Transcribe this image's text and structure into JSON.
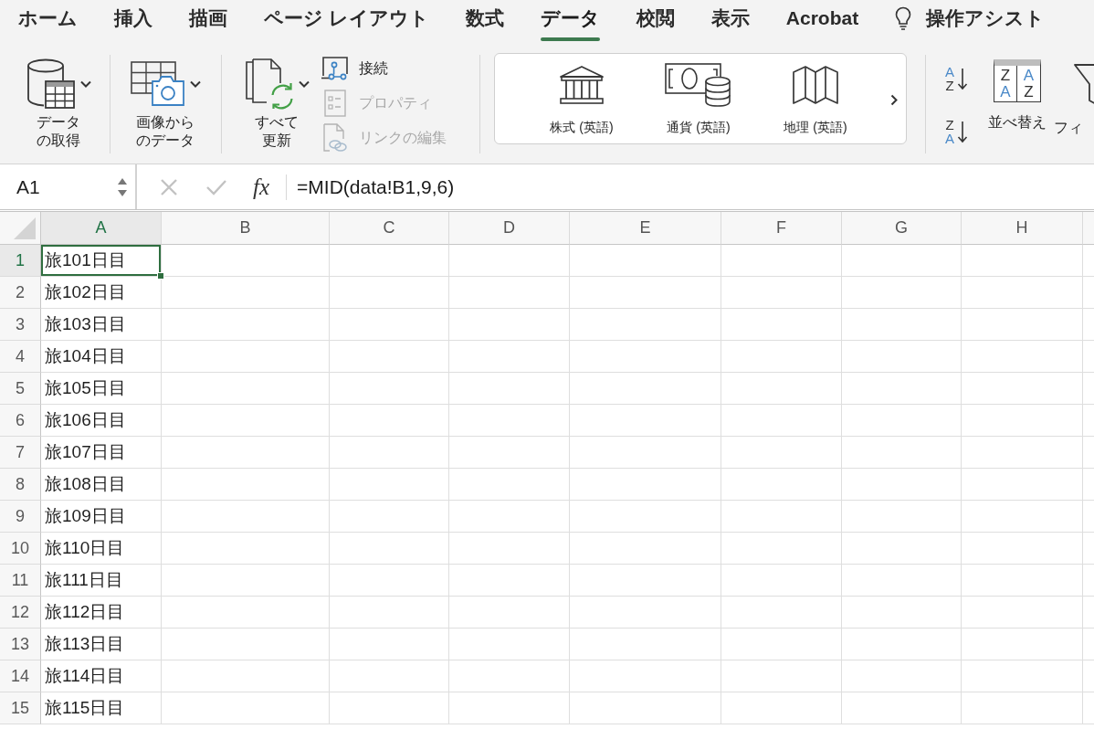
{
  "ribbon_tabs": [
    {
      "label": "ホーム",
      "selected": false
    },
    {
      "label": "挿入",
      "selected": false
    },
    {
      "label": "描画",
      "selected": false
    },
    {
      "label": "ページ レイアウト",
      "selected": false
    },
    {
      "label": "数式",
      "selected": false
    },
    {
      "label": "データ",
      "selected": true
    },
    {
      "label": "校閲",
      "selected": false
    },
    {
      "label": "表示",
      "selected": false
    },
    {
      "label": "Acrobat",
      "selected": false
    }
  ],
  "tell_me": {
    "label": "操作アシスト"
  },
  "ribbon": {
    "get_data": {
      "label": "データの取得"
    },
    "from_picture": {
      "label": "画像からのデータ"
    },
    "refresh_all": {
      "label": "すべて更新"
    },
    "queries": [
      {
        "label": "接続",
        "disabled": false
      },
      {
        "label": "プロパティ",
        "disabled": true
      },
      {
        "label": "リンクの編集",
        "disabled": true
      }
    ],
    "data_types": [
      {
        "label": "株式 (英語)"
      },
      {
        "label": "通貨 (英語)"
      },
      {
        "label": "地理 (英語)"
      }
    ],
    "sort_ascending": {
      "letters": [
        "A",
        "Z"
      ]
    },
    "sort_descending": {
      "letters": [
        "Z",
        "A"
      ]
    },
    "sort": {
      "letters": [
        [
          "Z",
          "A"
        ],
        [
          "A",
          "Z"
        ]
      ],
      "label": "並べ替え"
    },
    "filter": {
      "label": "フィ"
    }
  },
  "formula_bar": {
    "name_box": "A1",
    "function_button": "fx",
    "formula": "=MID(data!B1,9,6)"
  },
  "sheet": {
    "columns": [
      {
        "label": "A",
        "selected": true
      },
      {
        "label": "B",
        "selected": false
      },
      {
        "label": "C",
        "selected": false
      },
      {
        "label": "D",
        "selected": false
      },
      {
        "label": "E",
        "selected": false
      },
      {
        "label": "F",
        "selected": false
      },
      {
        "label": "G",
        "selected": false
      },
      {
        "label": "H",
        "selected": false
      }
    ],
    "rows": [
      {
        "label": "1",
        "selected": true,
        "cells": [
          {
            "value": "旅101日目",
            "active": true
          }
        ]
      },
      {
        "label": "2",
        "selected": false,
        "cells": [
          {
            "value": "旅102日目",
            "active": false
          }
        ]
      },
      {
        "label": "3",
        "selected": false,
        "cells": [
          {
            "value": "旅103日目",
            "active": false
          }
        ]
      },
      {
        "label": "4",
        "selected": false,
        "cells": [
          {
            "value": "旅104日目",
            "active": false
          }
        ]
      },
      {
        "label": "5",
        "selected": false,
        "cells": [
          {
            "value": "旅105日目",
            "active": false
          }
        ]
      },
      {
        "label": "6",
        "selected": false,
        "cells": [
          {
            "value": "旅106日目",
            "active": false
          }
        ]
      },
      {
        "label": "7",
        "selected": false,
        "cells": [
          {
            "value": "旅107日目",
            "active": false
          }
        ]
      },
      {
        "label": "8",
        "selected": false,
        "cells": [
          {
            "value": "旅108日目",
            "active": false
          }
        ]
      },
      {
        "label": "9",
        "selected": false,
        "cells": [
          {
            "value": "旅109日目",
            "active": false
          }
        ]
      },
      {
        "label": "10",
        "selected": false,
        "cells": [
          {
            "value": "旅110日目",
            "active": false
          }
        ]
      },
      {
        "label": "11",
        "selected": false,
        "cells": [
          {
            "value": "旅111日目",
            "active": false
          }
        ]
      },
      {
        "label": "12",
        "selected": false,
        "cells": [
          {
            "value": "旅112日目",
            "active": false
          }
        ]
      },
      {
        "label": "13",
        "selected": false,
        "cells": [
          {
            "value": "旅113日目",
            "active": false
          }
        ]
      },
      {
        "label": "14",
        "selected": false,
        "cells": [
          {
            "value": "旅114日目",
            "active": false
          }
        ]
      },
      {
        "label": "15",
        "selected": false,
        "cells": [
          {
            "value": "旅115日目",
            "active": false
          }
        ]
      }
    ]
  }
}
